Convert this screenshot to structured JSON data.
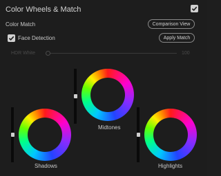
{
  "panel": {
    "title": "Color Wheels & Match",
    "enabled": true
  },
  "color_match": {
    "label": "Color Match",
    "comparison_view_label": "Comparison View",
    "face_detection_label": "Face Detection",
    "face_detection_checked": true,
    "apply_match_label": "Apply Match"
  },
  "hdr": {
    "label": "HDR White",
    "value": "100"
  },
  "wheels": {
    "midtones": {
      "label": "Midtones",
      "level": 0.5
    },
    "shadows": {
      "label": "Shadows",
      "level": 0.5
    },
    "highlights": {
      "label": "Highlights",
      "level": 0.5
    }
  },
  "colors": {
    "background": "#1d1d1d",
    "text": "#cfcfcf",
    "disabled_text": "#4b4b4b"
  }
}
